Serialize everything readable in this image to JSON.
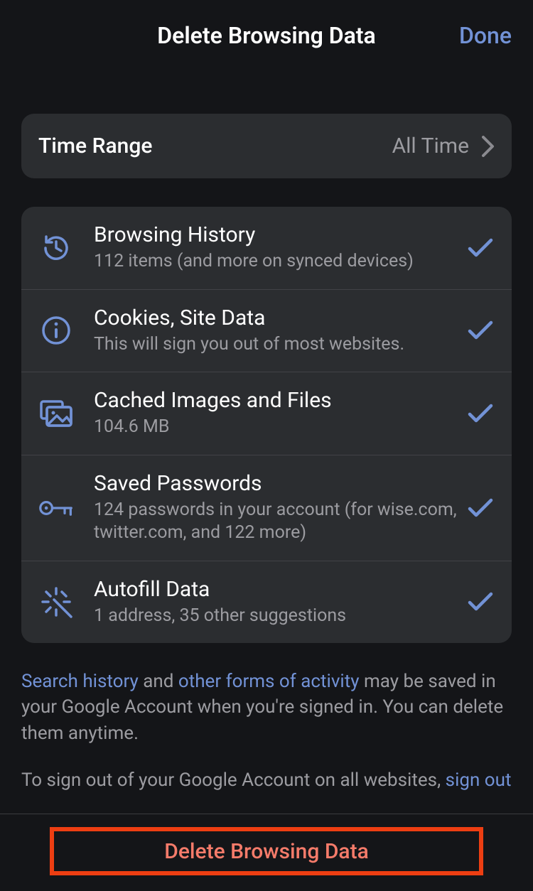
{
  "header": {
    "title": "Delete Browsing Data",
    "done_label": "Done"
  },
  "time_range": {
    "label": "Time Range",
    "value": "All Time"
  },
  "items": [
    {
      "icon": "history",
      "title": "Browsing History",
      "subtitle": "112 items (and more on synced devices)",
      "checked": true
    },
    {
      "icon": "info",
      "title": "Cookies, Site Data",
      "subtitle": "This will sign you out of most websites.",
      "checked": true
    },
    {
      "icon": "image",
      "title": "Cached Images and Files",
      "subtitle": "104.6 MB",
      "checked": true
    },
    {
      "icon": "key",
      "title": "Saved Passwords",
      "subtitle": "124 passwords in your account (for wise.com, twitter.com, and 122 more)",
      "checked": true
    },
    {
      "icon": "wand",
      "title": "Autofill Data",
      "subtitle": "1 address, 35 other suggestions",
      "checked": true
    }
  ],
  "footer": {
    "link1": "Search history",
    "txt1": " and ",
    "link2": "other forms of activity",
    "txt2": " may be saved in your Google Account when you're signed in. You can delete them anytime.",
    "txt3": "To sign out of your Google Account on all websites, ",
    "link3": "sign out"
  },
  "action": {
    "delete_label": "Delete Browsing Data"
  },
  "colors": {
    "accent": "#7292d6"
  }
}
